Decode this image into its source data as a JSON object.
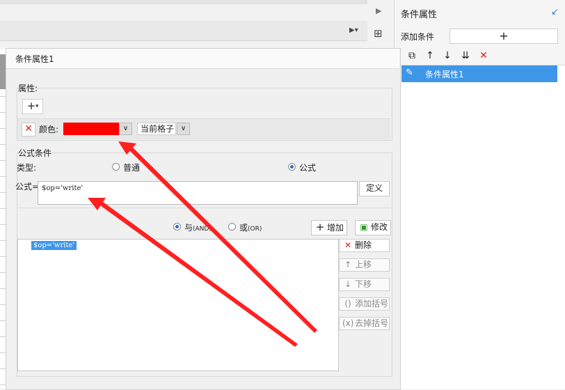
{
  "panel": {
    "title": "条件属性",
    "add_condition_label": "添加条件",
    "add_condition_icon": "plus-icon",
    "list_item": "条件属性1"
  },
  "dialog": {
    "title": "条件属性1",
    "attributes_group": "属性:",
    "color_label": "颜色:",
    "color_value": "#ff0000",
    "scope_value": "当前格子",
    "formula_group": "公式条件",
    "type_label": "类型:",
    "type_normal": "普通",
    "type_formula": "公式",
    "type_selected": "公式",
    "formula_label": "公式=",
    "formula_value": "$op='write'",
    "define_button": "定义",
    "and_label": "与",
    "and_en": "(AND)",
    "or_label": "或",
    "or_en": "(OR)",
    "logic_selected": "与",
    "add_button": "增加",
    "modify_button": "修改",
    "conditions": [
      "$op='write'"
    ],
    "delete_button": "删除",
    "move_up_button": "上移",
    "move_down_button": "下移",
    "add_bracket_button": "添加括号",
    "remove_bracket_button": "去掉括号"
  },
  "colors": {
    "accent": "#3e96e8",
    "annotation_arrow": "#ff2020",
    "delete_red": "#e02020"
  }
}
